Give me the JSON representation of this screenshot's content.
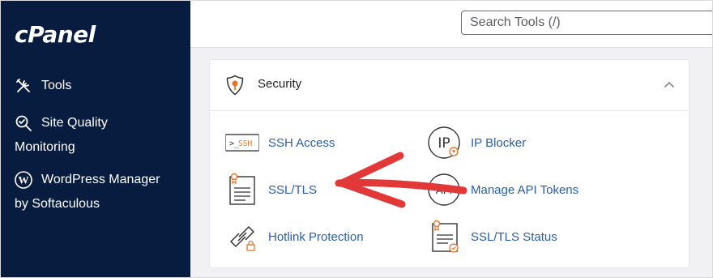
{
  "brand": {
    "logo_text": "cPanel"
  },
  "sidebar": {
    "items": [
      {
        "label": "Tools",
        "icon": "tools-icon"
      },
      {
        "label_line1": "Site Quality",
        "label_line2": "Monitoring",
        "icon": "site-quality-icon"
      },
      {
        "label_line1": "WordPress Manager",
        "label_line2": "by Softaculous",
        "icon": "wordpress-icon"
      }
    ]
  },
  "header": {
    "search_placeholder": "Search Tools (/)"
  },
  "security": {
    "title": "Security",
    "tools": [
      {
        "label": "SSH Access",
        "icon": "ssh-icon",
        "icon_text": ">_SSH"
      },
      {
        "label": "IP Blocker",
        "icon": "ip-blocker-icon",
        "icon_text": "IP"
      },
      {
        "label": "SSL/TLS",
        "icon": "ssl-tls-icon"
      },
      {
        "label": "Manage API Tokens",
        "icon": "api-tokens-icon",
        "icon_text": "API"
      },
      {
        "label": "Hotlink Protection",
        "icon": "hotlink-icon"
      },
      {
        "label": "SSL/TLS Status",
        "icon": "ssl-tls-status-icon"
      }
    ]
  },
  "colors": {
    "sidebar_bg": "#081c3f",
    "link": "#2a5ea8",
    "accent_orange": "#e8752a",
    "annotation_red": "#e23838"
  }
}
